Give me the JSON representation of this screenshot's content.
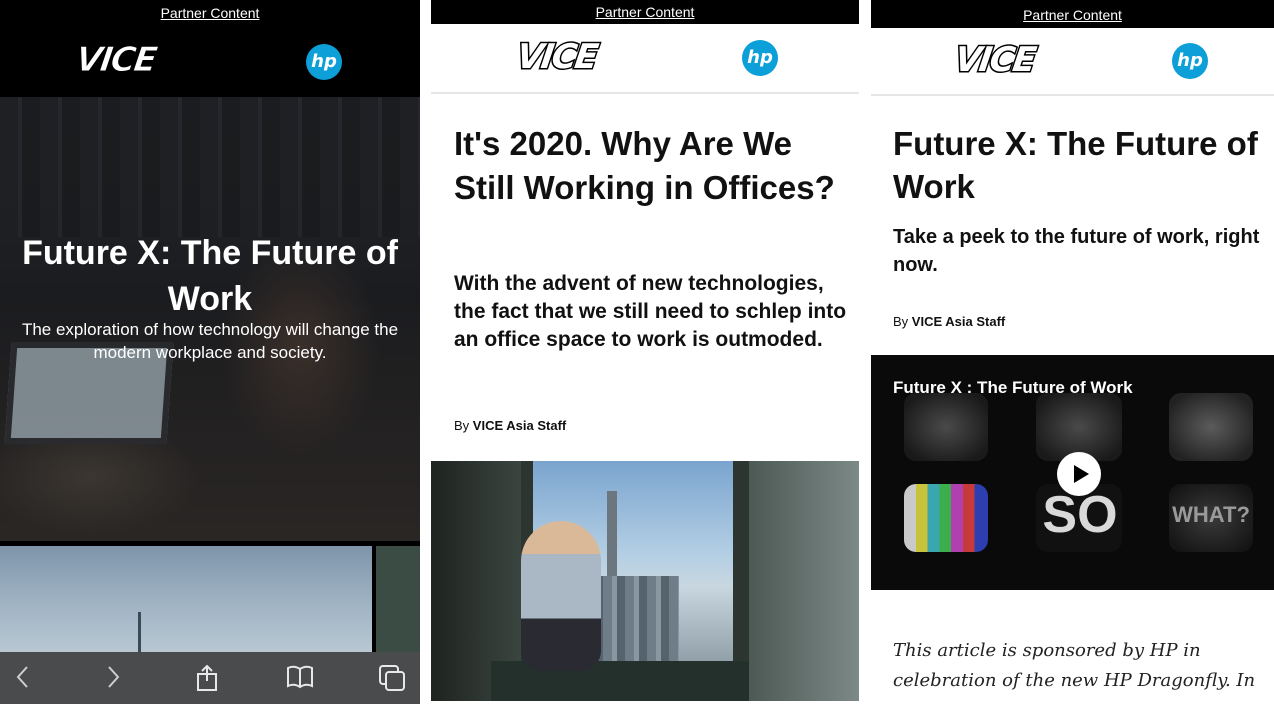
{
  "panel1": {
    "partner": "Partner Content",
    "vice_logo": "VICE",
    "hp_logo": "hp",
    "hero_title": "Future X: The Future of Work",
    "hero_subtitle": "The exploration of how technology will change the modern workplace and society.",
    "toolbar": {
      "back_icon": "chevron-left-icon",
      "forward_icon": "chevron-right-icon",
      "share_icon": "share-icon",
      "bookmarks_icon": "book-icon",
      "tabs_icon": "tabs-icon"
    }
  },
  "panel2": {
    "partner": "Partner Content",
    "vice_logo": "VICE",
    "hp_logo": "hp",
    "headline": "It's 2020. Why Are We Still Working in Offices?",
    "dek": "With the advent of new technologies, the fact that we still need to schlep into an office space to work is outmoded.",
    "byline_prefix": "By",
    "byline_author": "VICE Asia Staff"
  },
  "panel3": {
    "partner": "Partner Content",
    "vice_logo": "VICE",
    "hp_logo": "hp",
    "headline": "Future X: The Future of Work",
    "dek": "Take a peek to the future of work, right now.",
    "byline_prefix": "By",
    "byline_author": "VICE Asia Staff",
    "video_title": "Future X : The Future of Work",
    "video_so": "SO",
    "video_what": "WHAT?",
    "sponsor_text": "This article is sponsored by HP in celebration of the new HP Dragonfly. In"
  },
  "colors": {
    "hp_blue": "#0d9fd8",
    "black": "#000000",
    "toolbar_gray": "#4a4b4d"
  }
}
